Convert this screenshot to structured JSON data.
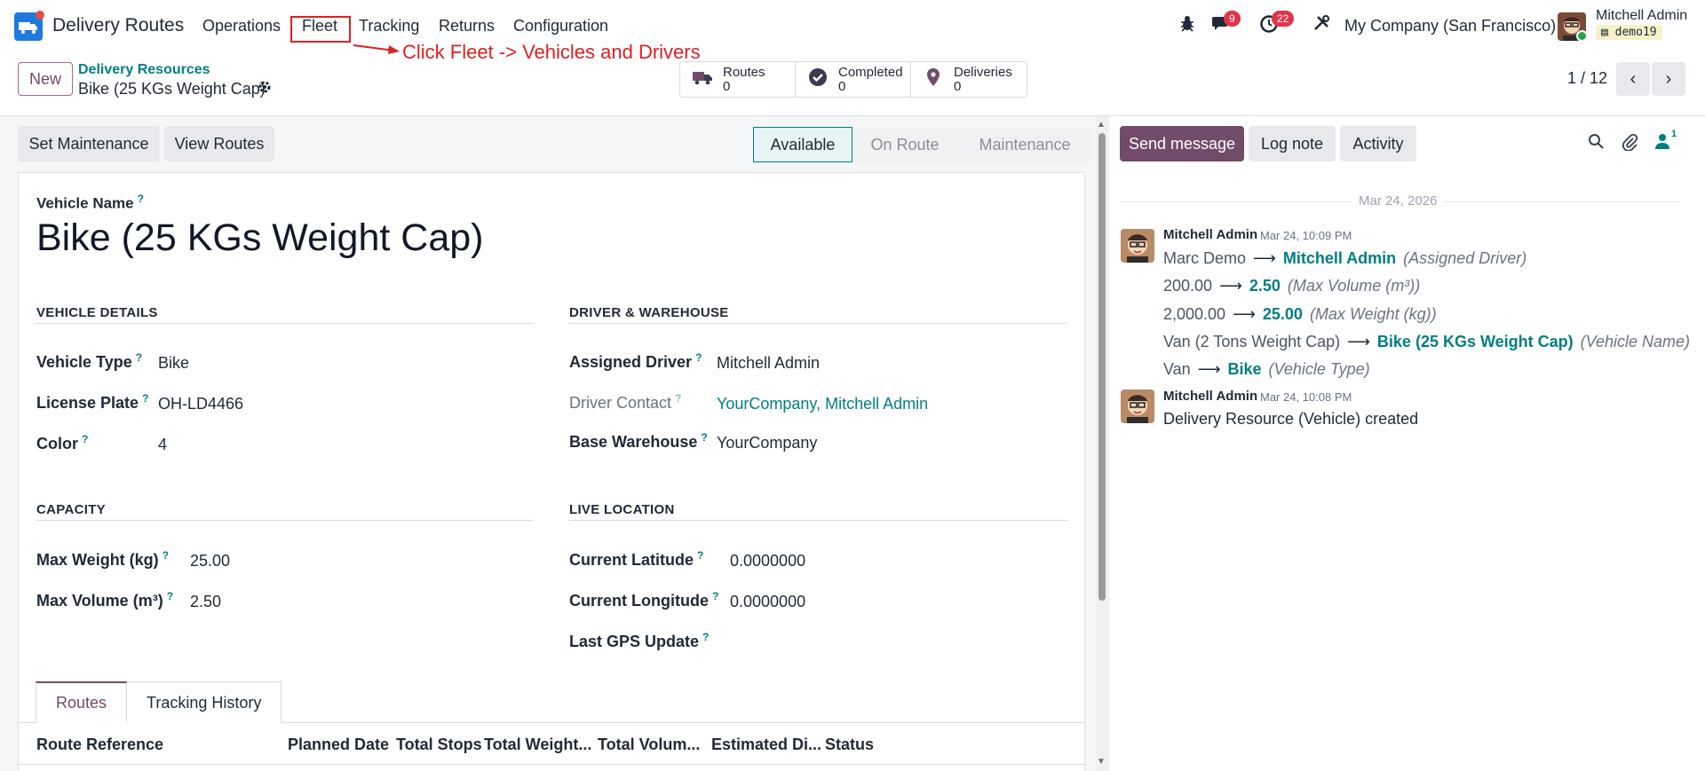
{
  "app": {
    "name": "Delivery Routes",
    "menu": [
      "Operations",
      "Fleet",
      "Tracking",
      "Returns",
      "Configuration"
    ]
  },
  "annotation": {
    "text": "Click Fleet -> Vehicles and Drivers"
  },
  "systray": {
    "messages_count": "9",
    "activities_count": "22",
    "company": "My Company (San Francisco)",
    "user_name": "Mitchell Admin",
    "database": "demo19"
  },
  "control_panel": {
    "new_label": "New",
    "breadcrumb_parent": "Delivery Resources",
    "breadcrumb_current": "Bike (25 KGs Weight Cap)",
    "smart_buttons": [
      {
        "icon": "truck-icon",
        "label": "Routes",
        "value": "0"
      },
      {
        "icon": "check-circle-icon",
        "label": "Completed",
        "value": "0"
      },
      {
        "icon": "map-marker-icon",
        "label": "Deliveries",
        "value": "0"
      }
    ],
    "pager": "1 / 12"
  },
  "form": {
    "buttons": [
      "Set Maintenance",
      "View Routes"
    ],
    "statusbar": {
      "steps": [
        "Available",
        "On Route",
        "Maintenance"
      ],
      "active": "Available"
    },
    "name_label": "Vehicle Name",
    "name_value": "Bike (25 KGs Weight Cap)",
    "vehicle_details": {
      "title": "VEHICLE DETAILS",
      "type_label": "Vehicle Type",
      "type_value": "Bike",
      "plate_label": "License Plate",
      "plate_value": "OH-LD4466",
      "color_label": "Color",
      "color_value": "4"
    },
    "driver_warehouse": {
      "title": "DRIVER & WAREHOUSE",
      "driver_label": "Assigned Driver",
      "driver_value": "Mitchell Admin",
      "contact_label": "Driver Contact",
      "contact_value": "YourCompany, Mitchell Admin",
      "warehouse_label": "Base Warehouse",
      "warehouse_value": "YourCompany"
    },
    "capacity": {
      "title": "CAPACITY",
      "weight_label": "Max Weight (kg)",
      "weight_value": "25.00",
      "volume_label": "Max Volume (m³)",
      "volume_value": "2.50"
    },
    "live_location": {
      "title": "LIVE LOCATION",
      "lat_label": "Current Latitude",
      "lat_value": "0.0000000",
      "lng_label": "Current Longitude",
      "lng_value": "0.0000000",
      "gps_label": "Last GPS Update"
    },
    "tabs": [
      "Routes",
      "Tracking History"
    ],
    "table_headers": [
      "Route Reference",
      "Planned Date",
      "Total Stops",
      "Total Weight...",
      "Total Volum...",
      "Estimated Di...",
      "Status"
    ]
  },
  "chatter": {
    "send_message": "Send message",
    "log_note": "Log note",
    "activity": "Activity",
    "followers_count": "1",
    "date_separator": "Mar 24, 2026",
    "messages": [
      {
        "author": "Mitchell Admin",
        "date": "Mar 24, 10:09 PM",
        "changes": [
          {
            "old": "Marc Demo",
            "new": "Mitchell Admin",
            "field": "(Assigned Driver)"
          },
          {
            "old": "200.00",
            "new": "2.50",
            "field": "(Max Volume (m³))"
          },
          {
            "old": "2,000.00",
            "new": "25.00",
            "field": "(Max Weight (kg))"
          },
          {
            "old": "Van (2 Tons Weight Cap)",
            "new": "Bike (25 KGs Weight Cap)",
            "field": "(Vehicle Name)"
          },
          {
            "old": "Van",
            "new": "Bike",
            "field": "(Vehicle Type)"
          }
        ]
      },
      {
        "author": "Mitchell Admin",
        "date": "Mar 24, 10:08 PM",
        "body": "Delivery Resource (Vehicle) created"
      }
    ]
  },
  "colors": {
    "primary": "#714b67",
    "link": "#017e84",
    "annotation": "#e02020",
    "badge": "#e0344b"
  }
}
